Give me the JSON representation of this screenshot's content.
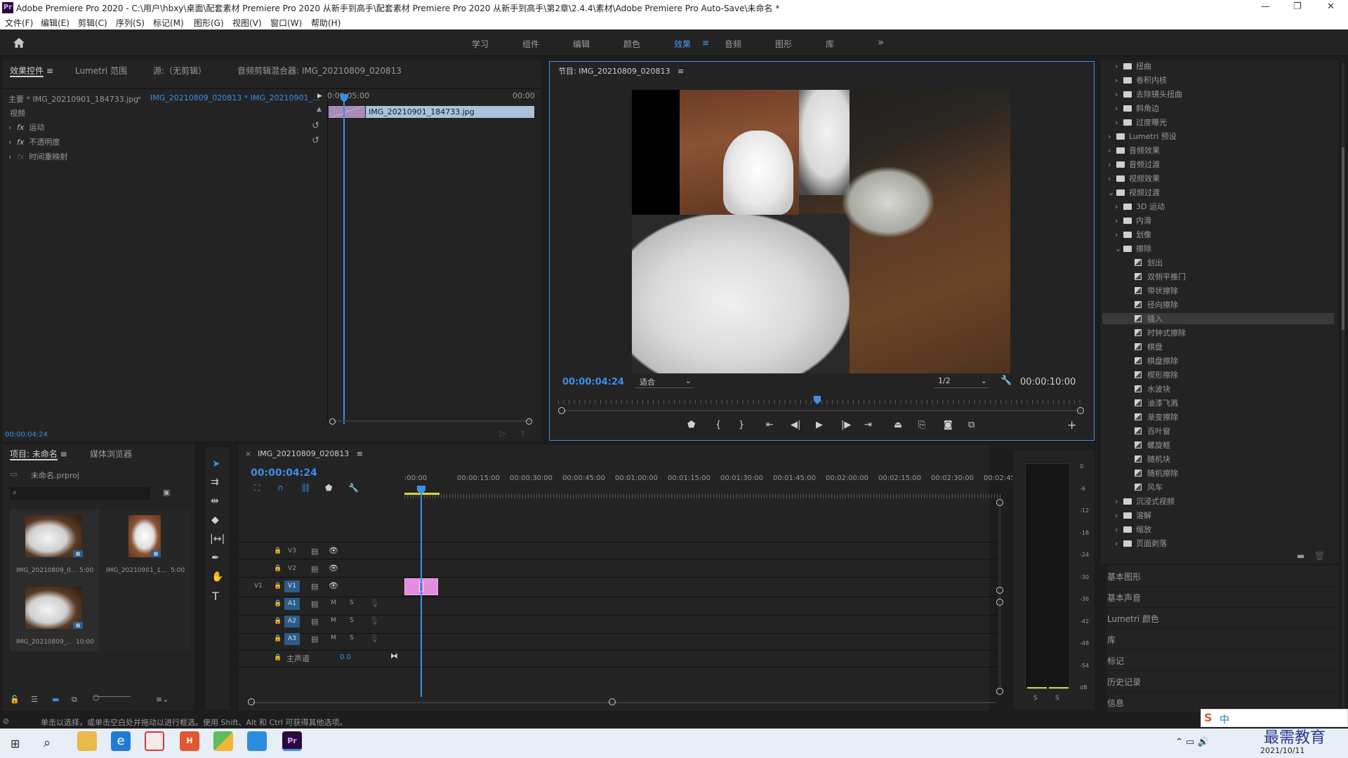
{
  "window": {
    "title": "Adobe Premiere Pro 2020 - C:\\用户\\hbxy\\桌面\\配套素材 Premiere Pro 2020 从新手到高手\\配套素材 Premiere Pro 2020 从新手到高手\\第2章\\2.4.4\\素材\\Adobe Premiere Pro Auto-Save\\未命名 *",
    "logo": "Pr"
  },
  "menu": [
    "文件(F)",
    "编辑(E)",
    "剪辑(C)",
    "序列(S)",
    "标记(M)",
    "图形(G)",
    "视图(V)",
    "窗口(W)",
    "帮助(H)"
  ],
  "workspaces": {
    "items": [
      "学习",
      "组件",
      "编辑",
      "颜色",
      "效果",
      "音频",
      "图形",
      "库"
    ],
    "active": "效果",
    "more": "»"
  },
  "effect_controls": {
    "tabs": [
      "效果控件",
      "Lumetri 范围",
      "源:（无剪辑）",
      "音频剪辑混合器: IMG_20210809_020813"
    ],
    "master_clip": "主要 * IMG_20210901_184733.jpg",
    "sequence_clip": "IMG_20210809_020813 * IMG_20210901_...",
    "ruler_start": "0:00:05:00",
    "ruler_end": "00:00",
    "clip_name": "IMG_20210901_184733.jpg",
    "section": "视频",
    "props": [
      {
        "fx": "fx",
        "name": "运动"
      },
      {
        "fx": "fx",
        "name": "不透明度"
      },
      {
        "fx": "fx",
        "name": "时间重映射"
      }
    ],
    "timecode": "00:00:04:24"
  },
  "program": {
    "title": "节目: IMG_20210809_020813",
    "timecode": "00:00:04:24",
    "fit": "适合",
    "resolution": "1/2",
    "duration": "00:00:10:00"
  },
  "project": {
    "tabs": [
      "项目: 未命名",
      "媒体浏览器"
    ],
    "file": "未命名.prproj",
    "search_placeholder": "",
    "items": [
      {
        "name": "IMG_20210809_0...",
        "dur": "5:00"
      },
      {
        "name": "IMG_20210901_1...",
        "dur": "5:00"
      },
      {
        "name": "IMG_20210809_...",
        "dur": "10:00"
      }
    ]
  },
  "timeline": {
    "title": "IMG_20210809_020813",
    "timecode": "00:00:04:24",
    "ruler": [
      ":00:00",
      "00:00:15:00",
      "00:00:30:00",
      "00:00:45:00",
      "00:01:00:00",
      "00:01:15:00",
      "00:01:30:00",
      "00:01:45:00",
      "00:02:00:00",
      "00:02:15:00",
      "00:02:30:00",
      "00:02:45:"
    ],
    "video_tracks": [
      "V3",
      "V2",
      "V1"
    ],
    "source_v1": "V1",
    "audio_tracks": [
      "A1",
      "A2",
      "A3"
    ],
    "m": "M",
    "s": "S",
    "master": "主声道",
    "master_val": "0.0"
  },
  "meter": {
    "labels": [
      "0",
      "-6",
      "-12",
      "-18",
      "-24",
      "-30",
      "-36",
      "-42",
      "-48",
      "-54",
      "dB"
    ],
    "solo": [
      "S",
      "S"
    ]
  },
  "effects_tree": [
    {
      "level": 1,
      "type": "folder",
      "label": "扭曲",
      "open": false
    },
    {
      "level": 1,
      "type": "folder",
      "label": "卷积内核",
      "open": false
    },
    {
      "level": 1,
      "type": "folder",
      "label": "去除镜头扭曲",
      "open": false
    },
    {
      "level": 1,
      "type": "folder",
      "label": "斜角边",
      "open": false
    },
    {
      "level": 1,
      "type": "folder",
      "label": "过度曝光",
      "open": false
    },
    {
      "level": 0,
      "type": "folder",
      "label": "Lumetri 预设",
      "open": false
    },
    {
      "level": 0,
      "type": "folder",
      "label": "音频效果",
      "open": false
    },
    {
      "level": 0,
      "type": "folder",
      "label": "音频过渡",
      "open": false
    },
    {
      "level": 0,
      "type": "folder",
      "label": "视频效果",
      "open": false
    },
    {
      "level": 0,
      "type": "folder",
      "label": "视频过渡",
      "open": true
    },
    {
      "level": 1,
      "type": "folder",
      "label": "3D 运动",
      "open": false
    },
    {
      "level": 1,
      "type": "folder",
      "label": "内滑",
      "open": false
    },
    {
      "level": 1,
      "type": "folder",
      "label": "划像",
      "open": false
    },
    {
      "level": 1,
      "type": "folder",
      "label": "擦除",
      "open": true
    },
    {
      "level": 2,
      "type": "fx",
      "label": "划出"
    },
    {
      "level": 2,
      "type": "fx",
      "label": "双侧平推门"
    },
    {
      "level": 2,
      "type": "fx",
      "label": "带状擦除"
    },
    {
      "level": 2,
      "type": "fx",
      "label": "径向擦除"
    },
    {
      "level": 2,
      "type": "fx",
      "label": "插入",
      "selected": true
    },
    {
      "level": 2,
      "type": "fx",
      "label": "时钟式擦除"
    },
    {
      "level": 2,
      "type": "fx",
      "label": "棋盘"
    },
    {
      "level": 2,
      "type": "fx",
      "label": "棋盘擦除"
    },
    {
      "level": 2,
      "type": "fx",
      "label": "楔形擦除"
    },
    {
      "level": 2,
      "type": "fx",
      "label": "水波块"
    },
    {
      "level": 2,
      "type": "fx",
      "label": "油漆飞溅"
    },
    {
      "level": 2,
      "type": "fx",
      "label": "渐变擦除"
    },
    {
      "level": 2,
      "type": "fx",
      "label": "百叶窗"
    },
    {
      "level": 2,
      "type": "fx",
      "label": "螺旋框"
    },
    {
      "level": 2,
      "type": "fx",
      "label": "随机块"
    },
    {
      "level": 2,
      "type": "fx",
      "label": "随机擦除"
    },
    {
      "level": 2,
      "type": "fx",
      "label": "风车"
    },
    {
      "level": 1,
      "type": "folder",
      "label": "沉浸式视频",
      "open": false
    },
    {
      "level": 1,
      "type": "folder",
      "label": "溶解",
      "open": false
    },
    {
      "level": 1,
      "type": "folder",
      "label": "缩放",
      "open": false
    },
    {
      "level": 1,
      "type": "folder",
      "label": "页面剥落",
      "open": false
    }
  ],
  "side_panels": [
    "基本图形",
    "基本声音",
    "Lumetri 颜色",
    "库",
    "标记",
    "历史记录",
    "信息"
  ],
  "status": "单击以选择，或单击空白处并拖动以进行框选。使用 Shift、Alt 和 Ctrl 可获得其他选项。",
  "taskbar": {
    "ime": "中",
    "date": "2021/10/11",
    "watermark": "最需教育"
  },
  "colors": {
    "accent": "#3e8ee6",
    "clip_pink": "#e38de0",
    "clip_blue": "#a9c3dc",
    "panel": "#232323"
  }
}
